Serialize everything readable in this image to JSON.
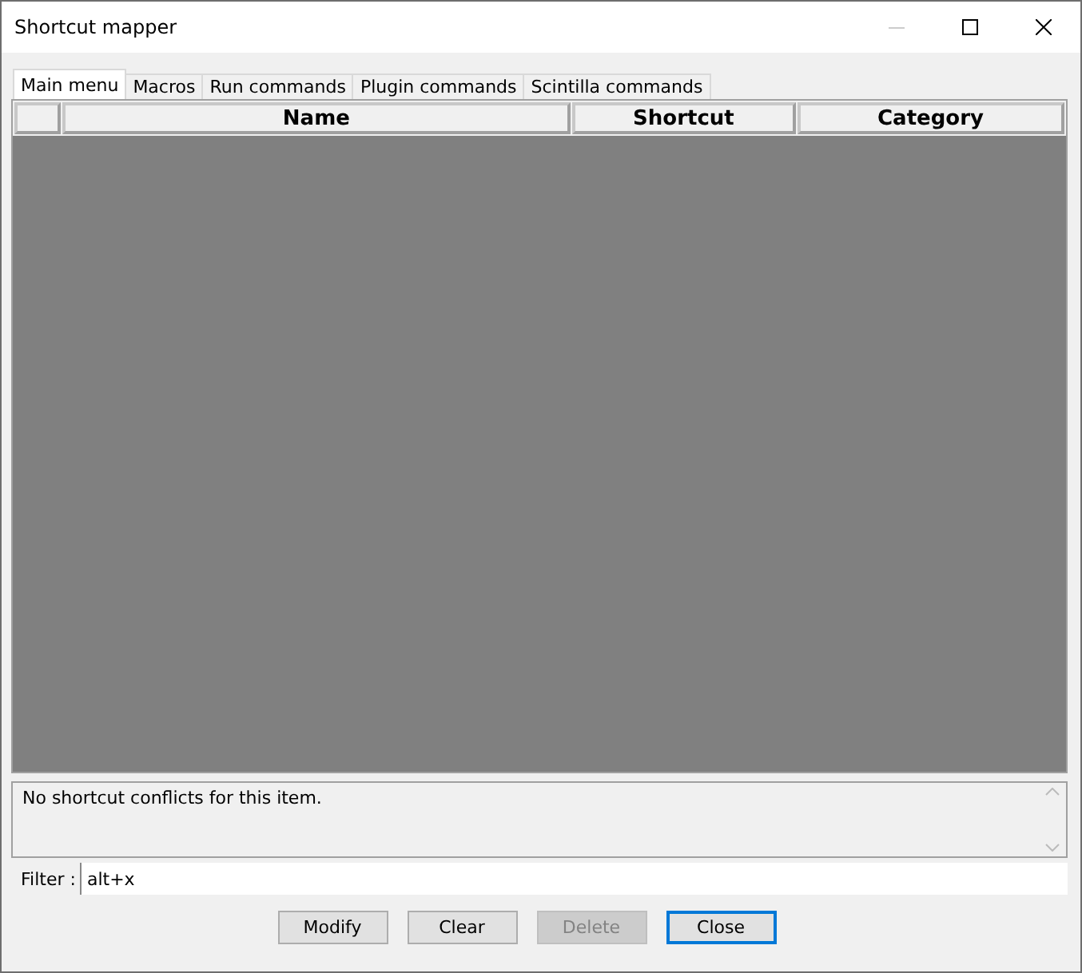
{
  "window": {
    "title": "Shortcut mapper"
  },
  "tabs": [
    {
      "label": "Main menu",
      "selected": true
    },
    {
      "label": "Macros",
      "selected": false
    },
    {
      "label": "Run commands",
      "selected": false
    },
    {
      "label": "Plugin commands",
      "selected": false
    },
    {
      "label": "Scintilla commands",
      "selected": false
    }
  ],
  "table": {
    "columns": [
      "Name",
      "Shortcut",
      "Category"
    ]
  },
  "conflicts": {
    "text": "No shortcut conflicts for this item."
  },
  "filter": {
    "label": "Filter :",
    "value": "alt+x"
  },
  "buttons": [
    {
      "label": "Modify",
      "disabled": false,
      "focused": false
    },
    {
      "label": "Clear",
      "disabled": false,
      "focused": false
    },
    {
      "label": "Delete",
      "disabled": true,
      "focused": false
    },
    {
      "label": "Close",
      "disabled": false,
      "focused": true
    }
  ]
}
